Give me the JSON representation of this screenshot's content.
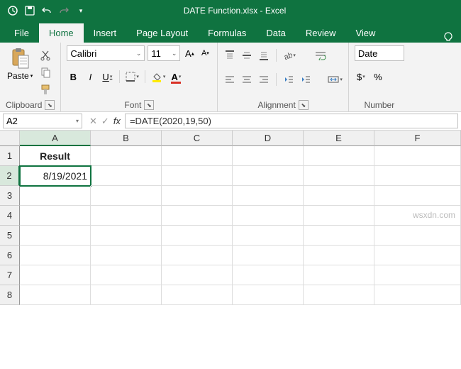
{
  "titlebar": {
    "title": "DATE Function.xlsx - Excel"
  },
  "tabs": {
    "file": "File",
    "home": "Home",
    "insert": "Insert",
    "page_layout": "Page Layout",
    "formulas": "Formulas",
    "data": "Data",
    "review": "Review",
    "view": "View"
  },
  "ribbon": {
    "clipboard": {
      "label": "Clipboard",
      "paste": "Paste"
    },
    "font": {
      "label": "Font",
      "name": "Calibri",
      "size": "11",
      "bold": "B",
      "italic": "I",
      "underline": "U"
    },
    "alignment": {
      "label": "Alignment"
    },
    "number": {
      "label": "Number",
      "format": "Date",
      "currency": "$",
      "percent": "%"
    }
  },
  "formula_bar": {
    "name_box": "A2",
    "fx": "fx",
    "formula": "=DATE(2020,19,50)"
  },
  "grid": {
    "columns": [
      "A",
      "B",
      "C",
      "D",
      "E",
      "F"
    ],
    "rows": [
      "1",
      "2",
      "3",
      "4",
      "5",
      "6",
      "7",
      "8"
    ],
    "cells": {
      "A1": "Result",
      "A2": "8/19/2021"
    },
    "active": "A2"
  },
  "watermark": "wsxdn.com"
}
